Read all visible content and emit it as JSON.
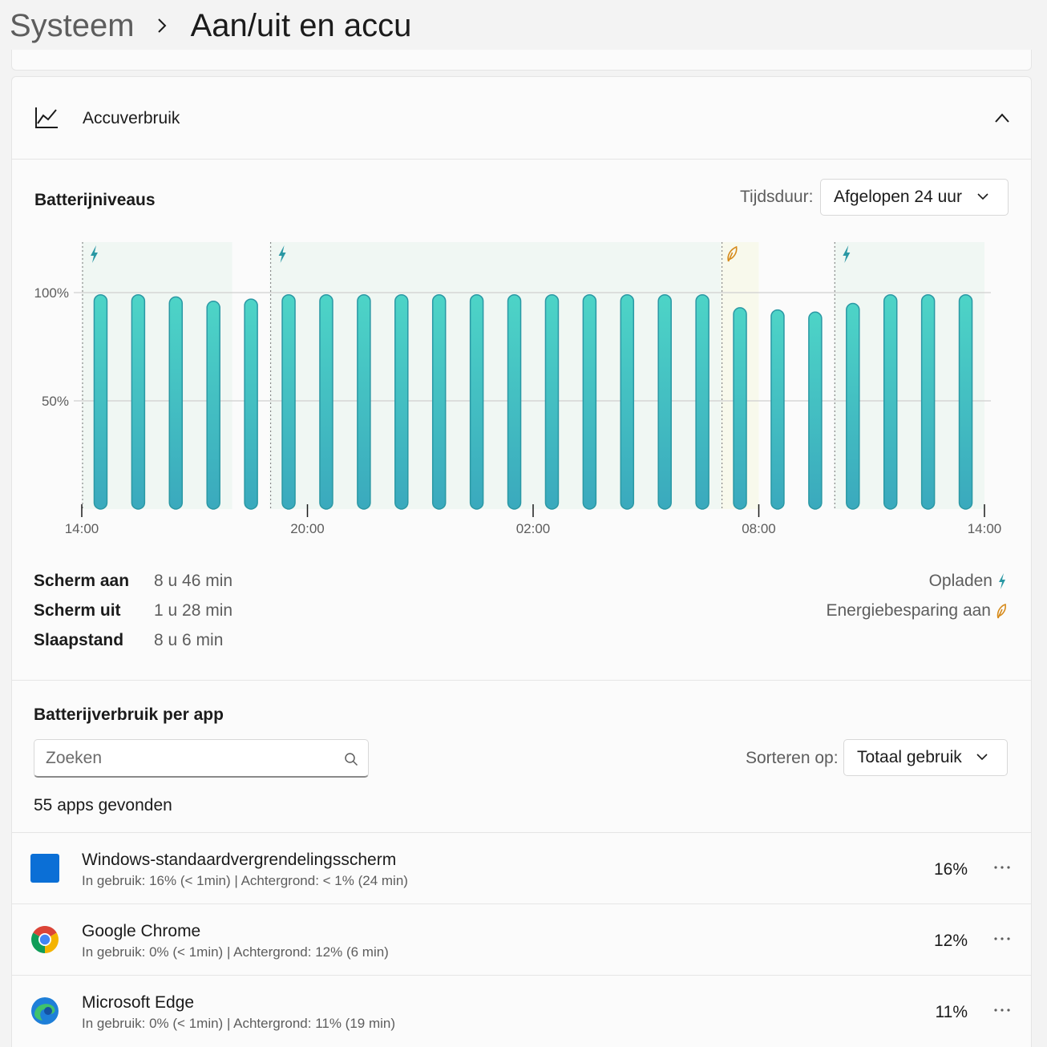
{
  "breadcrumb": {
    "parent": "Systeem",
    "current": "Aan/uit en accu"
  },
  "expander": {
    "title": "Accuverbruik",
    "icon": "chart-line-icon"
  },
  "battery": {
    "title": "Batterijniveaus",
    "duration_label": "Tijdsduur:",
    "duration_value": "Afgelopen 24 uur"
  },
  "chart_data": {
    "type": "bar",
    "x_ticks": [
      "14:00",
      "20:00",
      "02:00",
      "08:00",
      "14:00"
    ],
    "y_ticks": [
      "100%",
      "50%"
    ],
    "ylim": [
      0,
      100
    ],
    "values": [
      99,
      99,
      98,
      96,
      97,
      99,
      99,
      99,
      99,
      99,
      99,
      99,
      99,
      99,
      99,
      99,
      99,
      93,
      92,
      91,
      95,
      99,
      99,
      99
    ],
    "states": [
      "c",
      "c",
      "c",
      "c",
      "n",
      "c",
      "c",
      "c",
      "c",
      "c",
      "c",
      "c",
      "c",
      "c",
      "c",
      "c",
      "c",
      "s",
      "n",
      "n",
      "c",
      "c",
      "c",
      "c"
    ],
    "state_legend": {
      "c": "Opladen",
      "s": "Energiebesparing aan",
      "n": ""
    },
    "colors": {
      "bar_top": "#4dd4c7",
      "bar_bottom": "#3aa9bd",
      "bar_stroke": "#2a98a4",
      "charge_bg": "#f0f7f3",
      "saver_bg": "#f8f9ec",
      "charge_icon": "#2a98a4",
      "saver_icon": "#d68a1a"
    },
    "grid": true
  },
  "stats": [
    {
      "label": "Scherm aan",
      "value": "8 u 46 min"
    },
    {
      "label": "Scherm uit",
      "value": "1 u 28 min"
    },
    {
      "label": "Slaapstand",
      "value": "8 u 6 min"
    }
  ],
  "legend": {
    "charging": "Opladen",
    "saver": "Energiebesparing aan"
  },
  "apps_section": {
    "title": "Batterijverbruik per app",
    "search_placeholder": "Zoeken",
    "sort_label": "Sorteren op:",
    "sort_value": "Totaal gebruik",
    "count": "55 apps gevonden"
  },
  "apps": [
    {
      "name": "Windows-standaardvergrendelingsscherm",
      "detail": "In gebruik: 16% (< 1min) | Achtergrond: < 1% (24 min)",
      "pct": "16%",
      "icon": "windows-lockscreen-icon"
    },
    {
      "name": "Google Chrome",
      "detail": "In gebruik: 0% (< 1min) | Achtergrond: 12% (6 min)",
      "pct": "12%",
      "icon": "chrome-icon"
    },
    {
      "name": "Microsoft Edge",
      "detail": "In gebruik: 0% (< 1min) | Achtergrond: 11% (19 min)",
      "pct": "11%",
      "icon": "edge-icon"
    }
  ]
}
